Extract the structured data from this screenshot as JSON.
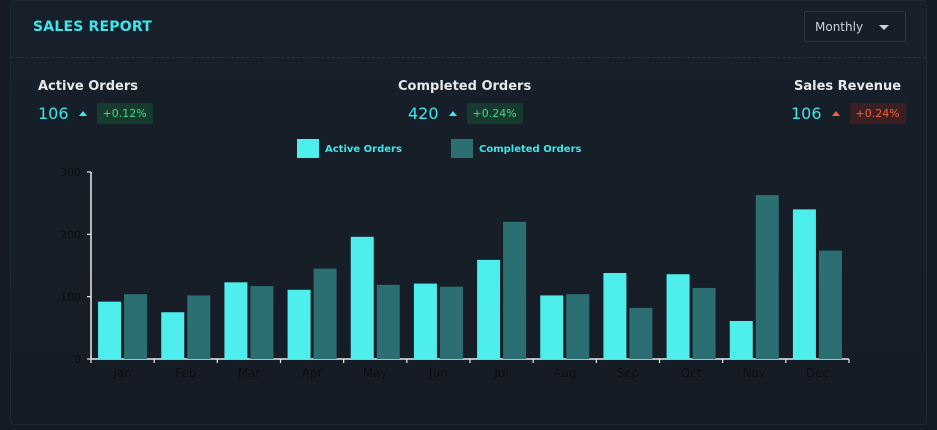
{
  "header": {
    "title": "SALES REPORT",
    "period_dropdown": {
      "selected": "Monthly"
    }
  },
  "stats": [
    {
      "label": "Active Orders",
      "value": "106",
      "change": "+0.12%",
      "trend": "up",
      "trend_color": "#44d78a"
    },
    {
      "label": "Completed Orders",
      "value": "420",
      "change": "+0.24%",
      "trend": "up",
      "trend_color": "#44d78a"
    },
    {
      "label": "Sales Revenue",
      "value": "106",
      "change": "+0.24%",
      "trend": "up",
      "trend_color": "#f0643c"
    }
  ],
  "colors": {
    "accent": "#3ee6ea",
    "active_series": "#4eeeed",
    "completed_series": "#2c6f73",
    "positive": "#44d78a",
    "negative": "#f0643c"
  },
  "chart_data": {
    "type": "bar",
    "categories": [
      "Jan",
      "Feb",
      "Mar",
      "Apr",
      "May",
      "Jun",
      "Jul",
      "Aug",
      "Sep",
      "Oct",
      "Nov",
      "Dec"
    ],
    "series": [
      {
        "name": "Active Orders",
        "values": [
          92,
          75,
          123,
          111,
          196,
          121,
          159,
          102,
          138,
          136,
          61,
          240
        ]
      },
      {
        "name": "Completed Orders",
        "values": [
          104,
          102,
          117,
          145,
          119,
          116,
          220,
          104,
          82,
          114,
          263,
          174
        ]
      }
    ],
    "yticks": [
      0,
      100,
      200,
      300
    ],
    "ylim": [
      0,
      300
    ],
    "legend": "top-center",
    "grid": false
  }
}
